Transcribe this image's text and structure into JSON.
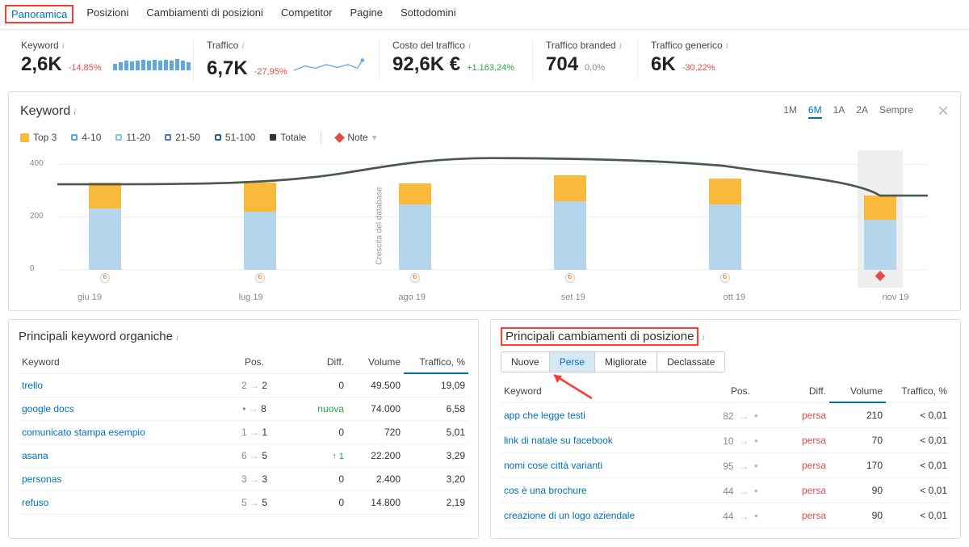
{
  "nav": [
    "Panoramica",
    "Posizioni",
    "Cambiamenti di posizioni",
    "Competitor",
    "Pagine",
    "Sottodomini"
  ],
  "kpi": {
    "keyword": {
      "label": "Keyword",
      "value": "2,6K",
      "delta": "-14,85%"
    },
    "traffic": {
      "label": "Traffico",
      "value": "6,7K",
      "delta": "-27,95%"
    },
    "cost": {
      "label": "Costo del traffico",
      "value": "92,6K €",
      "delta": "+1.163,24%"
    },
    "branded": {
      "label": "Traffico branded",
      "value": "704",
      "delta": "0,0%"
    },
    "generic": {
      "label": "Traffico generico",
      "value": "6K",
      "delta": "-30,22%"
    }
  },
  "panel": {
    "title": "Keyword",
    "legend": [
      "Top 3",
      "4-10",
      "11-20",
      "21-50",
      "51-100",
      "Totale"
    ],
    "note": "Note",
    "range": [
      "1M",
      "6M",
      "1A",
      "2A",
      "Sempre"
    ],
    "months": [
      "giu 19",
      "lug 19",
      "ago 19",
      "set 19",
      "ott 19",
      "nov 19"
    ],
    "dbgrowth": "Crescita del database",
    "yticks": [
      "0",
      "200",
      "400"
    ]
  },
  "left": {
    "title": "Principali keyword organiche",
    "head": [
      "Keyword",
      "Pos.",
      "Diff.",
      "Volume",
      "Traffico, %"
    ],
    "rows": [
      {
        "kw": "trello",
        "p1": "2",
        "p2": "2",
        "diff": "0",
        "vol": "49.500",
        "traf": "19,09"
      },
      {
        "kw": "google docs",
        "p1": "•",
        "p2": "8",
        "diff": "nuova",
        "vol": "74.000",
        "traf": "6,58",
        "new": true
      },
      {
        "kw": "comunicato stampa esempio",
        "p1": "1",
        "p2": "1",
        "diff": "0",
        "vol": "720",
        "traf": "5,01"
      },
      {
        "kw": "asana",
        "p1": "6",
        "p2": "5",
        "diff": "↑ 1",
        "vol": "22.200",
        "traf": "3,29",
        "up": true
      },
      {
        "kw": "personas",
        "p1": "3",
        "p2": "3",
        "diff": "0",
        "vol": "2.400",
        "traf": "3,20"
      },
      {
        "kw": "refuso",
        "p1": "5",
        "p2": "5",
        "diff": "0",
        "vol": "14.800",
        "traf": "2,19"
      }
    ]
  },
  "right": {
    "title": "Principali cambiamenti di posizione",
    "pills": [
      "Nuove",
      "Perse",
      "Migliorate",
      "Declassate"
    ],
    "head": [
      "Keyword",
      "Pos.",
      "Diff.",
      "Volume",
      "Traffico, %"
    ],
    "rows": [
      {
        "kw": "app che legge testi",
        "p1": "82",
        "diff": "persa",
        "vol": "210",
        "traf": "< 0,01"
      },
      {
        "kw": "link di natale su facebook",
        "p1": "10",
        "diff": "persa",
        "vol": "70",
        "traf": "< 0,01"
      },
      {
        "kw": "nomi cose città varianti",
        "p1": "95",
        "diff": "persa",
        "vol": "170",
        "traf": "< 0,01"
      },
      {
        "kw": "cos è una brochure",
        "p1": "44",
        "diff": "persa",
        "vol": "90",
        "traf": "< 0,01"
      },
      {
        "kw": "creazione di un logo aziendale",
        "p1": "44",
        "diff": "persa",
        "vol": "90",
        "traf": "< 0,01"
      }
    ]
  },
  "chart_data": {
    "type": "bar",
    "categories": [
      "giu 19",
      "lug 19",
      "ago 19",
      "set 19",
      "ott 19",
      "nov 19"
    ],
    "series": [
      {
        "name": "Top 3",
        "values": [
          100,
          110,
          80,
          100,
          100,
          90
        ]
      },
      {
        "name": "4-10",
        "values": [
          235,
          220,
          250,
          260,
          250,
          190
        ]
      }
    ],
    "line": {
      "name": "Totale",
      "values": [
        335,
        335,
        375,
        370,
        350,
        300
      ]
    },
    "ylim": [
      0,
      400
    ],
    "yticks": [
      0,
      200,
      400
    ]
  }
}
